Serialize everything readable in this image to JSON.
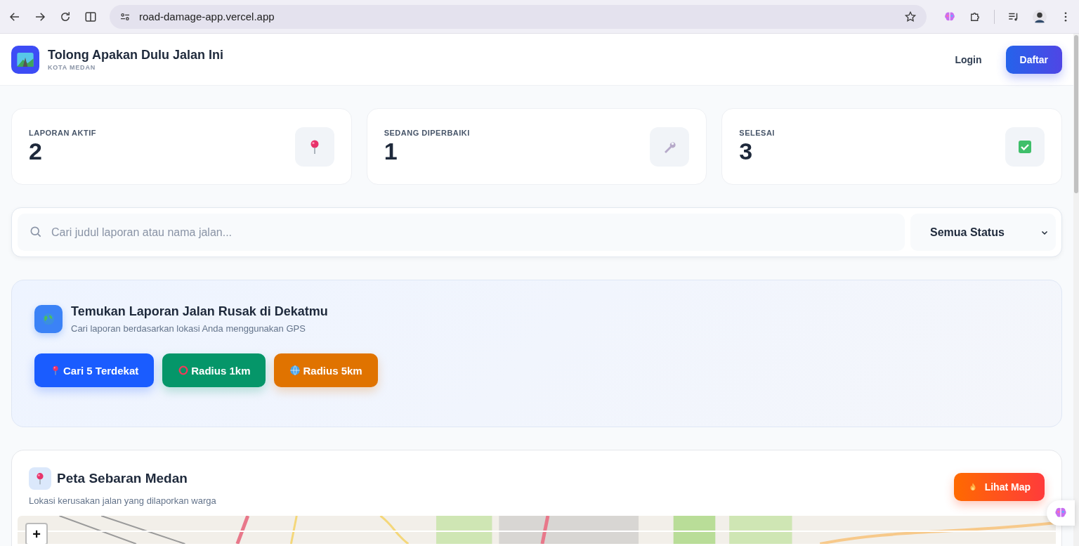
{
  "browser": {
    "url": "road-damage-app.vercel.app"
  },
  "header": {
    "title": "Tolong Apakan Dulu Jalan Ini",
    "subtitle": "KOTA MEDAN",
    "actions": [
      {
        "label": "Login",
        "kind": "link"
      },
      {
        "label": "Daftar",
        "kind": "primary"
      }
    ]
  },
  "stats": [
    {
      "label": "LAPORAN AKTIF",
      "value": "2",
      "kind": "pin"
    },
    {
      "label": "SEDANG DIPERBAIKI",
      "value": "1",
      "kind": "wrench"
    },
    {
      "label": "SELESAI",
      "value": "3",
      "kind": "check"
    }
  ],
  "filter": {
    "search": {
      "placeholder": "Cari judul laporan atau nama jalan..."
    },
    "status": {
      "value": "Semua Status"
    }
  },
  "nearby": {
    "title": "Temukan Laporan Jalan Rusak di Dekatmu",
    "subtitle": "Cari laporan berdasarkan lokasi Anda menggunakan GPS",
    "buttons": [
      {
        "label": "Cari 5 Terdekat",
        "kind": "pin",
        "color": "#1a5cff"
      },
      {
        "label": "Radius 1km",
        "kind": "ring",
        "color": "#059669"
      },
      {
        "label": "Radius 5km",
        "kind": "globe",
        "color": "#e07300"
      }
    ]
  },
  "map": {
    "title": "Peta Sebaran Medan",
    "subtitle": "Lokasi kerusakan jalan yang dilaporkan warga",
    "button": "Lihat Map",
    "zoom_in": "+",
    "kind": "picture"
  }
}
